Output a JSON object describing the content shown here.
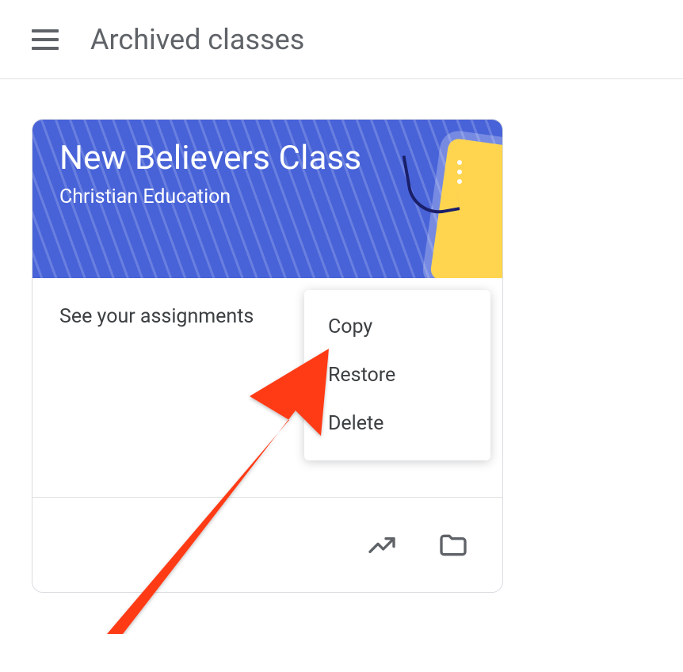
{
  "header": {
    "title": "Archived classes"
  },
  "card": {
    "title": "New Believers Class",
    "subtitle": "Christian Education",
    "assignments_label": "See your assignments"
  },
  "menu": {
    "items": [
      "Copy",
      "Restore",
      "Delete"
    ]
  }
}
